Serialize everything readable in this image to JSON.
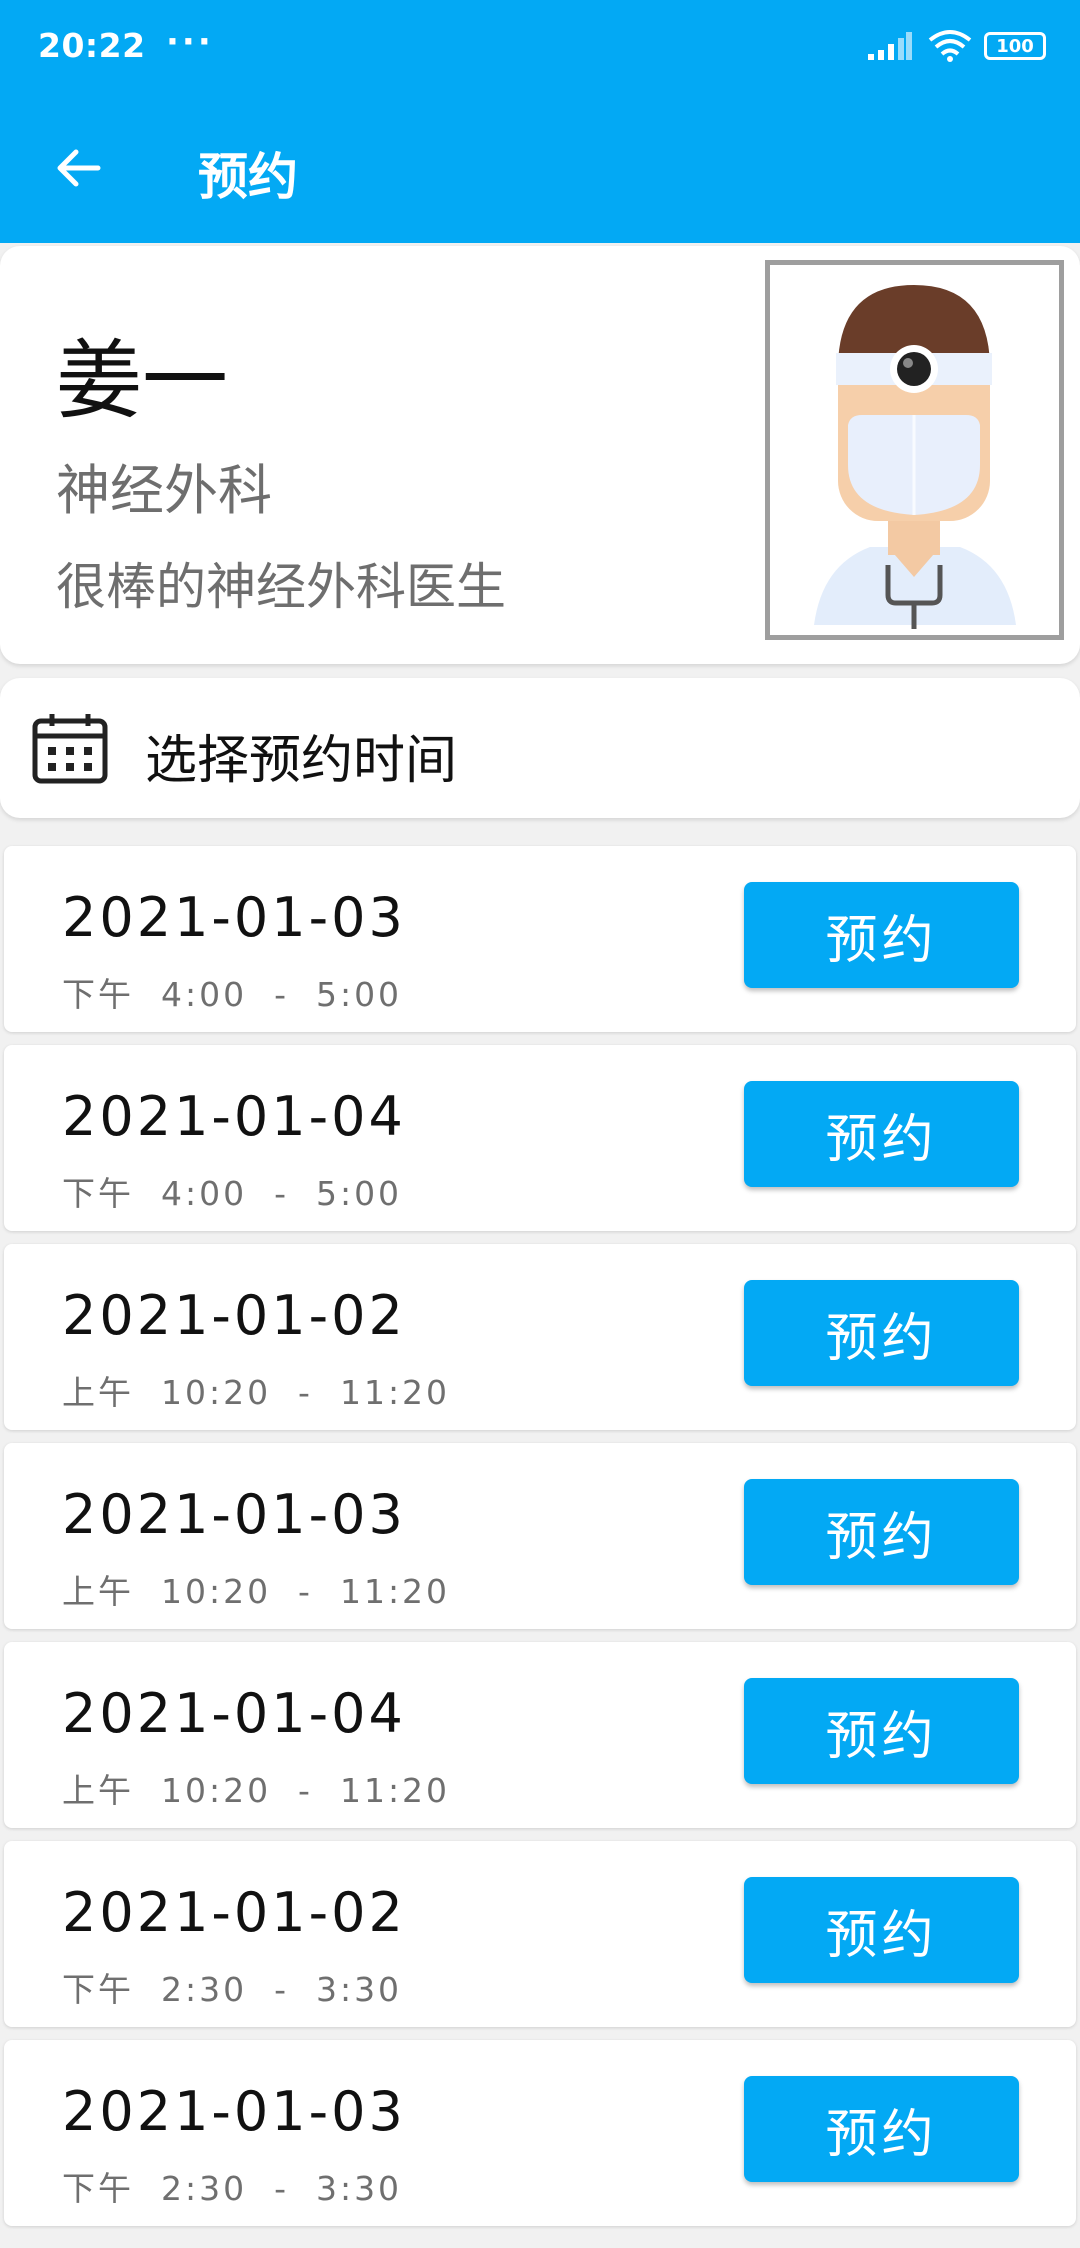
{
  "status_bar": {
    "time": "20:22",
    "more": "···",
    "battery": "100"
  },
  "toolbar": {
    "title": "预约"
  },
  "doctor": {
    "name": "姜一",
    "department": "神经外科",
    "description": "很棒的神经外科医生"
  },
  "schedule": {
    "label": "选择预约时间"
  },
  "slots": [
    {
      "date": "2021-01-03",
      "time": "下午  4:00  -  5:00",
      "button": "预约"
    },
    {
      "date": "2021-01-04",
      "time": "下午  4:00  -  5:00",
      "button": "预约"
    },
    {
      "date": "2021-01-02",
      "time": "上午  10:20  -  11:20",
      "button": "预约"
    },
    {
      "date": "2021-01-03",
      "time": "上午  10:20  -  11:20",
      "button": "预约"
    },
    {
      "date": "2021-01-04",
      "time": "上午  10:20  -  11:20",
      "button": "预约"
    },
    {
      "date": "2021-01-02",
      "time": "下午  2:30  -  3:30",
      "button": "预约"
    },
    {
      "date": "2021-01-03",
      "time": "下午  2:30  -  3:30",
      "button": "预约"
    }
  ],
  "colors": {
    "primary": "#03a9f4",
    "background": "#f1f1f1",
    "secondary_text": "#6e6e6e"
  }
}
